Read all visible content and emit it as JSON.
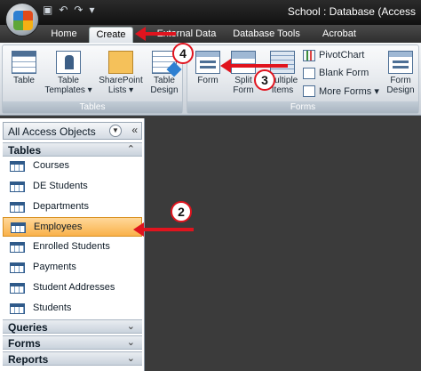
{
  "window": {
    "title": "School : Database (Access"
  },
  "tabs": [
    {
      "label": "Home"
    },
    {
      "label": "Create"
    },
    {
      "label": "External Data"
    },
    {
      "label": "Database Tools"
    },
    {
      "label": "Acrobat"
    }
  ],
  "ribbon": {
    "tables_group": {
      "label": "Tables",
      "buttons": [
        {
          "label": "Table"
        },
        {
          "label": "Table Templates ▾"
        },
        {
          "label": "SharePoint Lists ▾"
        },
        {
          "label": "Table Design"
        }
      ]
    },
    "forms_group": {
      "label": "Forms",
      "buttons": [
        {
          "label": "Form"
        },
        {
          "label": "Split Form"
        },
        {
          "label": "Multiple Items"
        },
        {
          "label": "Form Design"
        }
      ],
      "small_buttons": [
        {
          "label": "PivotChart"
        },
        {
          "label": "Blank Form"
        },
        {
          "label": "More Forms ▾"
        }
      ]
    }
  },
  "nav_pane": {
    "header": "All Access Objects",
    "categories": {
      "tables": "Tables",
      "queries": "Queries",
      "forms": "Forms",
      "reports": "Reports"
    },
    "items": [
      {
        "label": "Courses"
      },
      {
        "label": "DE Students"
      },
      {
        "label": "Departments"
      },
      {
        "label": "Employees"
      },
      {
        "label": "Enrolled Students"
      },
      {
        "label": "Payments"
      },
      {
        "label": "Student Addresses"
      },
      {
        "label": "Students"
      }
    ]
  },
  "annotations": [
    {
      "number": "2"
    },
    {
      "number": "3"
    },
    {
      "number": "4"
    }
  ],
  "colors": {
    "annotation": "#e0141e",
    "selected": "#f9b14a"
  }
}
